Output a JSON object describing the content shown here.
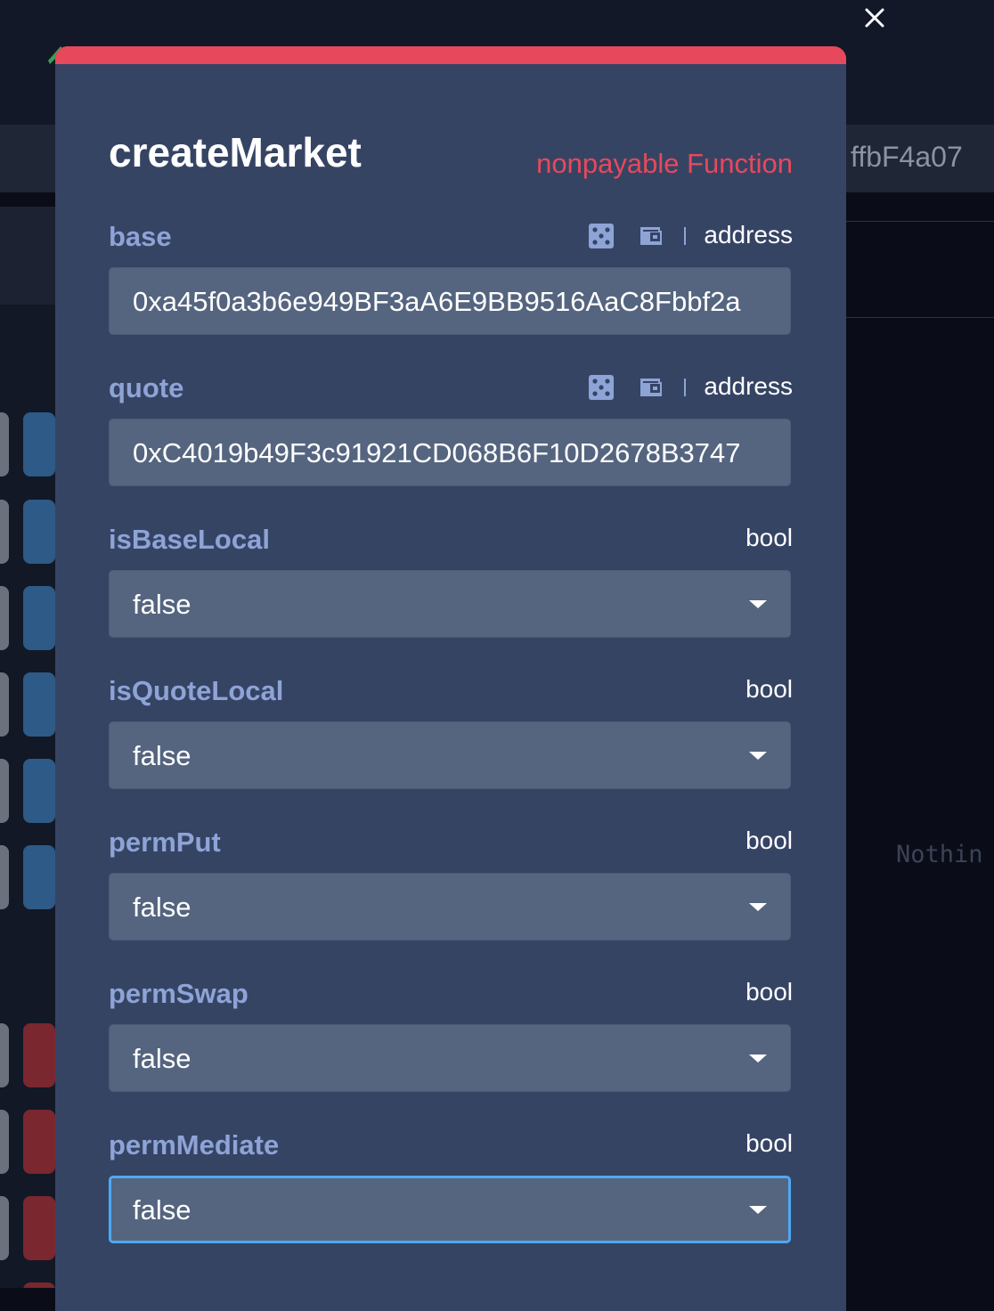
{
  "background": {
    "address_fragment": "ffbF4a07",
    "empty_text": "Nothin"
  },
  "modal": {
    "title": "createMarket",
    "subtitle": "nonpayable Function",
    "close_icon": "close-icon",
    "accent_color": "#e8485b",
    "fields": [
      {
        "label": "base",
        "type": "address",
        "value": "0xa45f0a3b6e949BF3aA6E9BB9516AaC8Fbbf2a",
        "icons": [
          "dice-icon",
          "wallet-icon"
        ]
      },
      {
        "label": "quote",
        "type": "address",
        "value": "0xC4019b49F3c91921CD068B6F10D2678B3747",
        "icons": [
          "dice-icon",
          "wallet-icon"
        ]
      },
      {
        "label": "isBaseLocal",
        "type": "bool",
        "value": "false"
      },
      {
        "label": "isQuoteLocal",
        "type": "bool",
        "value": "false"
      },
      {
        "label": "permPut",
        "type": "bool",
        "value": "false"
      },
      {
        "label": "permSwap",
        "type": "bool",
        "value": "false"
      },
      {
        "label": "permMediate",
        "type": "bool",
        "value": "false"
      }
    ]
  }
}
